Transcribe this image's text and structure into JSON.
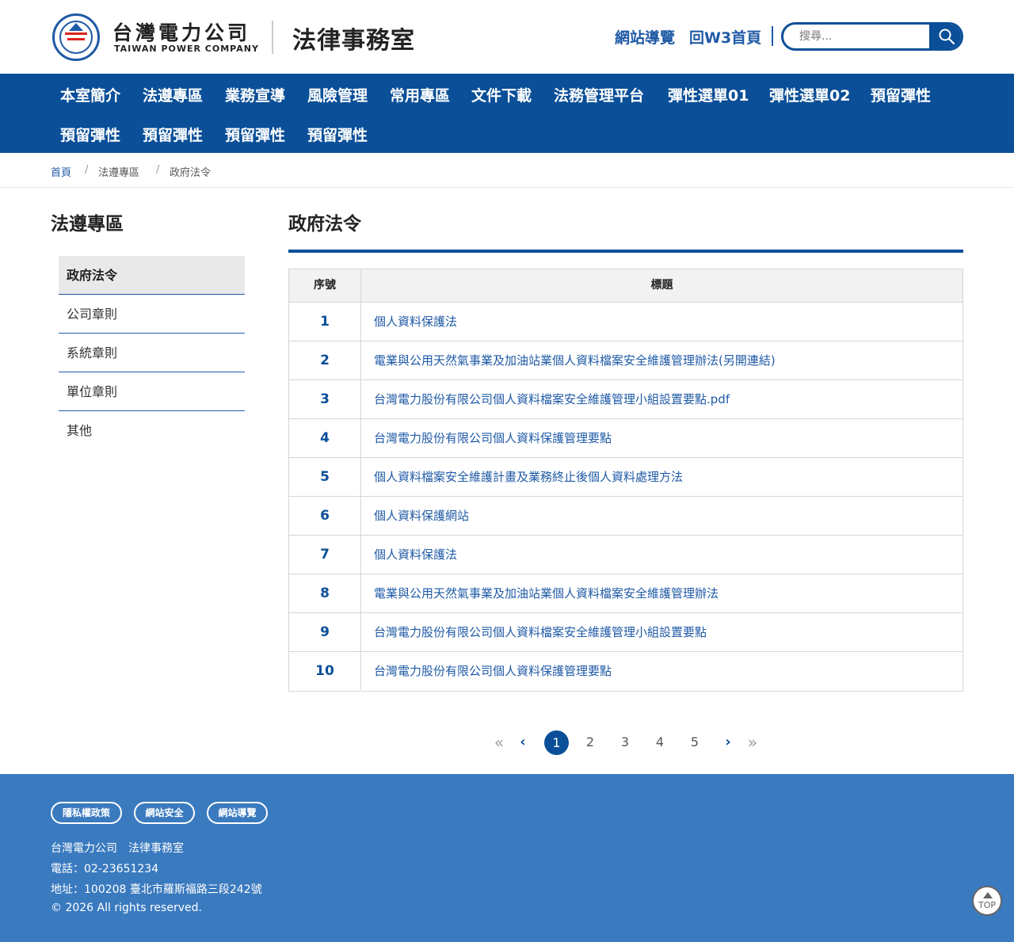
{
  "header": {
    "company_zh": "台灣電力公司",
    "company_en": "TAIWAN POWER COMPANY",
    "site_title": "法律事務室",
    "links": {
      "sitemap": "網站導覽",
      "w3_home": "回W3首頁"
    },
    "search": {
      "placeholder": "搜尋...",
      "icon": "search-icon"
    }
  },
  "nav": {
    "items": [
      "本室簡介",
      "法遵專區",
      "業務宣導",
      "風險管理",
      "常用專區",
      "文件下載",
      "法務管理平台",
      "彈性選單01",
      "彈性選單02",
      "預留彈性",
      "預留彈性",
      "預留彈性",
      "預留彈性",
      "預留彈性"
    ]
  },
  "breadcrumb": {
    "home": "首頁",
    "sep": "/",
    "section": "法遵專區",
    "current": "政府法令"
  },
  "sidebar": {
    "title": "法遵專區",
    "items": [
      "政府法令",
      "公司章則",
      "系統章則",
      "單位章則",
      "其他"
    ]
  },
  "content": {
    "title": "政府法令",
    "table": {
      "headers": {
        "no": "序號",
        "title": "標題"
      },
      "rows": [
        {
          "no": "1",
          "title": "個人資料保護法"
        },
        {
          "no": "2",
          "title": "電業與公用天然氣事業及加油站業個人資料檔案安全維護管理辦法(另開連結)"
        },
        {
          "no": "3",
          "title": "台灣電力股份有限公司個人資料檔案安全維護管理小組設置要點.pdf"
        },
        {
          "no": "4",
          "title": "台灣電力股份有限公司個人資料保護管理要點"
        },
        {
          "no": "5",
          "title": "個人資料檔案安全維護計畫及業務終止後個人資料處理方法"
        },
        {
          "no": "6",
          "title": "個人資料保護網站"
        },
        {
          "no": "7",
          "title": "個人資料保護法"
        },
        {
          "no": "8",
          "title": "電業與公用天然氣事業及加油站業個人資料檔案安全維護管理辦法"
        },
        {
          "no": "9",
          "title": "台灣電力股份有限公司個人資料檔案安全維護管理小組設置要點"
        },
        {
          "no": "10",
          "title": "台灣電力股份有限公司個人資料保護管理要點"
        }
      ]
    }
  },
  "pagination": {
    "first": "«",
    "prev": "‹",
    "next": "›",
    "last": "»",
    "pages": [
      "1",
      "2",
      "3",
      "4",
      "5"
    ],
    "current": "1"
  },
  "footer": {
    "links": [
      "隱私權政策",
      "網站安全",
      "網站導覽"
    ],
    "org": "台灣電力公司　法律事務室",
    "phone": "電話：02-23651234",
    "address": "地址：100208 臺北市羅斯福路三段242號",
    "copyright": "© 2026 All rights reserved.",
    "top_button": "TOP"
  },
  "colors": {
    "primary": "#0a4f98",
    "link": "#1f5aa6",
    "footer": "#3a7abf",
    "logo_red": "#d9241c"
  }
}
